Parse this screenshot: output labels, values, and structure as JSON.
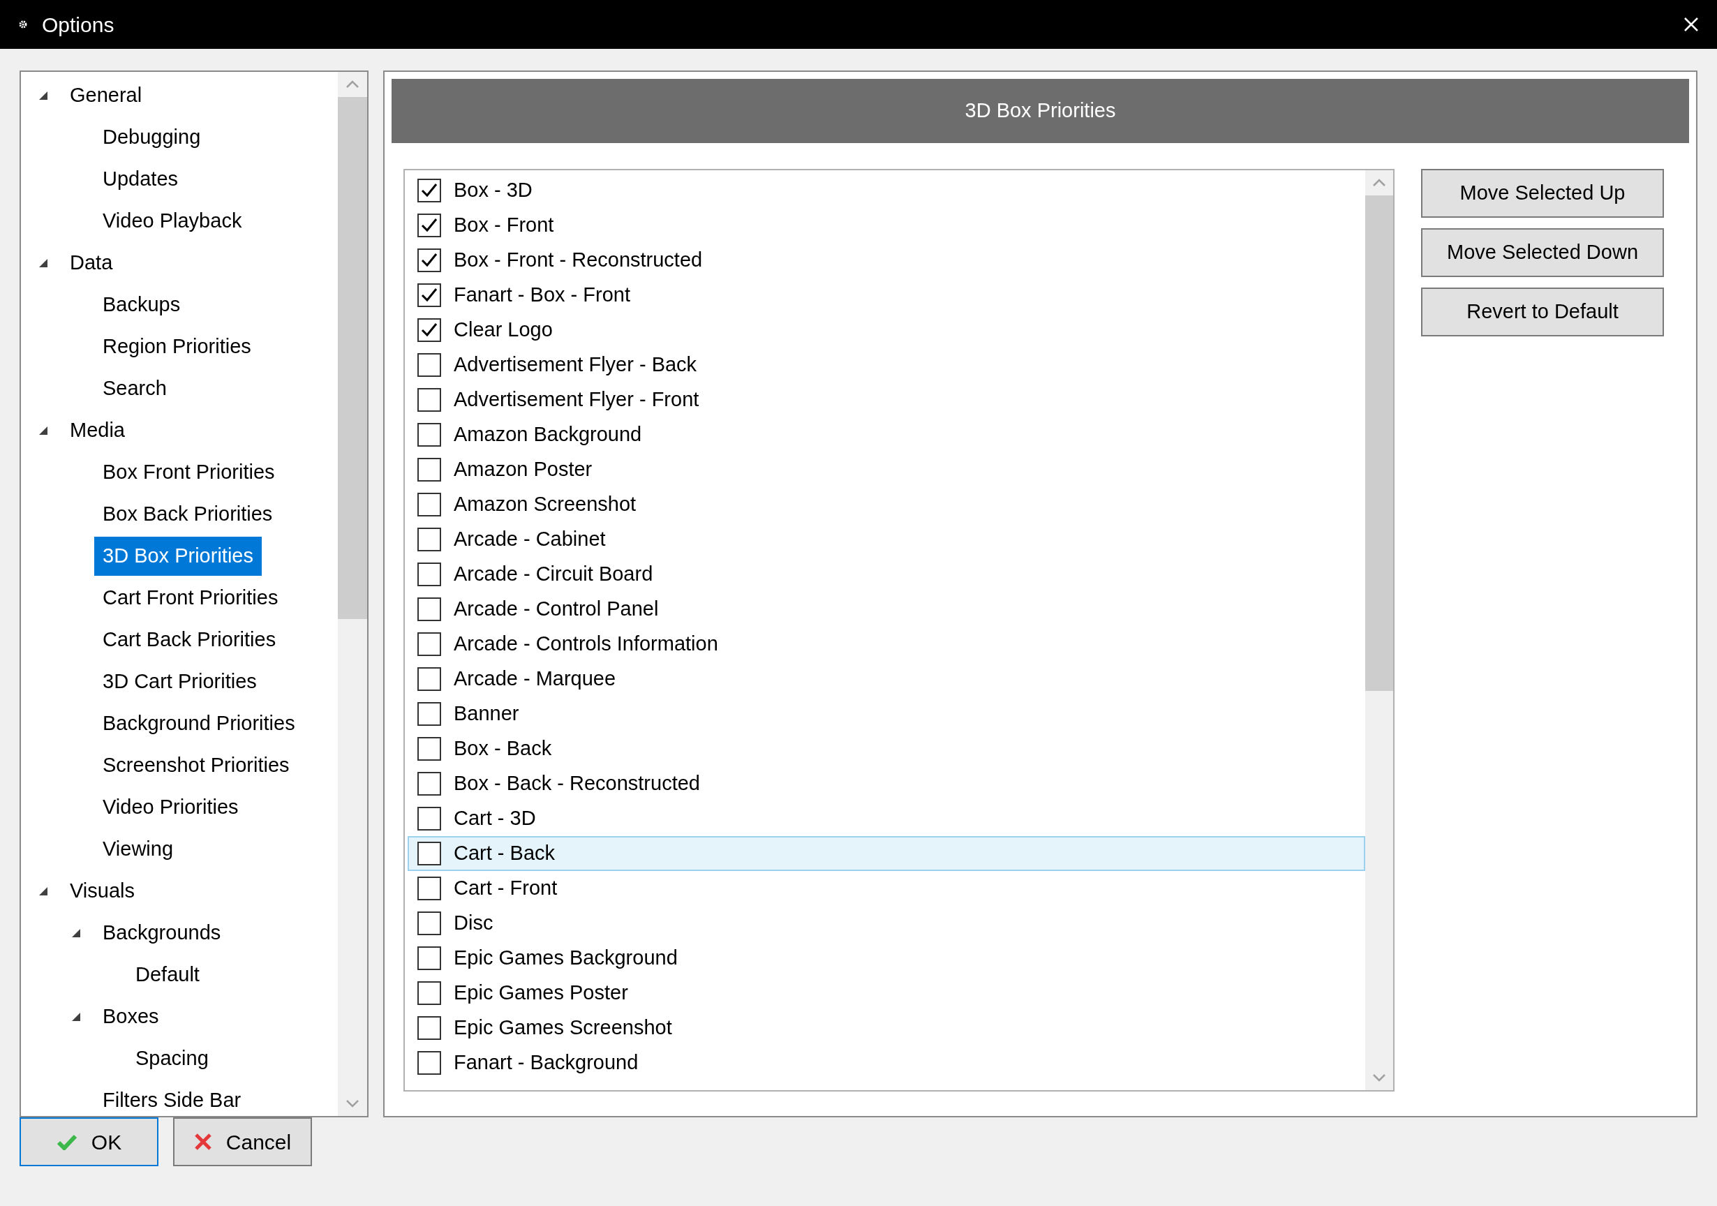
{
  "window": {
    "title": "Options"
  },
  "tree": [
    {
      "label": "General",
      "expanded": true,
      "selected": false,
      "children": [
        {
          "label": "Debugging",
          "selected": false
        },
        {
          "label": "Updates",
          "selected": false
        },
        {
          "label": "Video Playback",
          "selected": false
        }
      ]
    },
    {
      "label": "Data",
      "expanded": true,
      "selected": false,
      "children": [
        {
          "label": "Backups",
          "selected": false
        },
        {
          "label": "Region Priorities",
          "selected": false
        },
        {
          "label": "Search",
          "selected": false
        }
      ]
    },
    {
      "label": "Media",
      "expanded": true,
      "selected": false,
      "children": [
        {
          "label": "Box Front Priorities",
          "selected": false
        },
        {
          "label": "Box Back Priorities",
          "selected": false
        },
        {
          "label": "3D Box Priorities",
          "selected": true
        },
        {
          "label": "Cart Front Priorities",
          "selected": false
        },
        {
          "label": "Cart Back Priorities",
          "selected": false
        },
        {
          "label": "3D Cart Priorities",
          "selected": false
        },
        {
          "label": "Background Priorities",
          "selected": false
        },
        {
          "label": "Screenshot Priorities",
          "selected": false
        },
        {
          "label": "Video Priorities",
          "selected": false
        },
        {
          "label": "Viewing",
          "selected": false
        }
      ]
    },
    {
      "label": "Visuals",
      "expanded": true,
      "selected": false,
      "children": [
        {
          "label": "Backgrounds",
          "expanded": true,
          "selected": false,
          "children": [
            {
              "label": "Default",
              "selected": false
            }
          ]
        },
        {
          "label": "Boxes",
          "expanded": true,
          "selected": false,
          "children": [
            {
              "label": "Spacing",
              "selected": false
            }
          ]
        },
        {
          "label": "Filters Side Bar",
          "selected": false
        }
      ]
    }
  ],
  "panel": {
    "header": "3D Box Priorities",
    "items": [
      {
        "label": "Box - 3D",
        "checked": true,
        "selected": false
      },
      {
        "label": "Box - Front",
        "checked": true,
        "selected": false
      },
      {
        "label": "Box - Front - Reconstructed",
        "checked": true,
        "selected": false
      },
      {
        "label": "Fanart - Box - Front",
        "checked": true,
        "selected": false
      },
      {
        "label": "Clear Logo",
        "checked": true,
        "selected": false
      },
      {
        "label": "Advertisement Flyer - Back",
        "checked": false,
        "selected": false
      },
      {
        "label": "Advertisement Flyer - Front",
        "checked": false,
        "selected": false
      },
      {
        "label": "Amazon Background",
        "checked": false,
        "selected": false
      },
      {
        "label": "Amazon Poster",
        "checked": false,
        "selected": false
      },
      {
        "label": "Amazon Screenshot",
        "checked": false,
        "selected": false
      },
      {
        "label": "Arcade - Cabinet",
        "checked": false,
        "selected": false
      },
      {
        "label": "Arcade - Circuit Board",
        "checked": false,
        "selected": false
      },
      {
        "label": "Arcade - Control Panel",
        "checked": false,
        "selected": false
      },
      {
        "label": "Arcade - Controls Information",
        "checked": false,
        "selected": false
      },
      {
        "label": "Arcade - Marquee",
        "checked": false,
        "selected": false
      },
      {
        "label": "Banner",
        "checked": false,
        "selected": false
      },
      {
        "label": "Box - Back",
        "checked": false,
        "selected": false
      },
      {
        "label": "Box - Back - Reconstructed",
        "checked": false,
        "selected": false
      },
      {
        "label": "Cart - 3D",
        "checked": false,
        "selected": false
      },
      {
        "label": "Cart - Back",
        "checked": false,
        "selected": true
      },
      {
        "label": "Cart - Front",
        "checked": false,
        "selected": false
      },
      {
        "label": "Disc",
        "checked": false,
        "selected": false
      },
      {
        "label": "Epic Games Background",
        "checked": false,
        "selected": false
      },
      {
        "label": "Epic Games Poster",
        "checked": false,
        "selected": false
      },
      {
        "label": "Epic Games Screenshot",
        "checked": false,
        "selected": false
      },
      {
        "label": "Fanart - Background",
        "checked": false,
        "selected": false
      }
    ],
    "buttons": [
      "Move Selected Up",
      "Move Selected Down",
      "Revert to Default"
    ]
  },
  "footer": {
    "ok": "OK",
    "cancel": "Cancel"
  }
}
